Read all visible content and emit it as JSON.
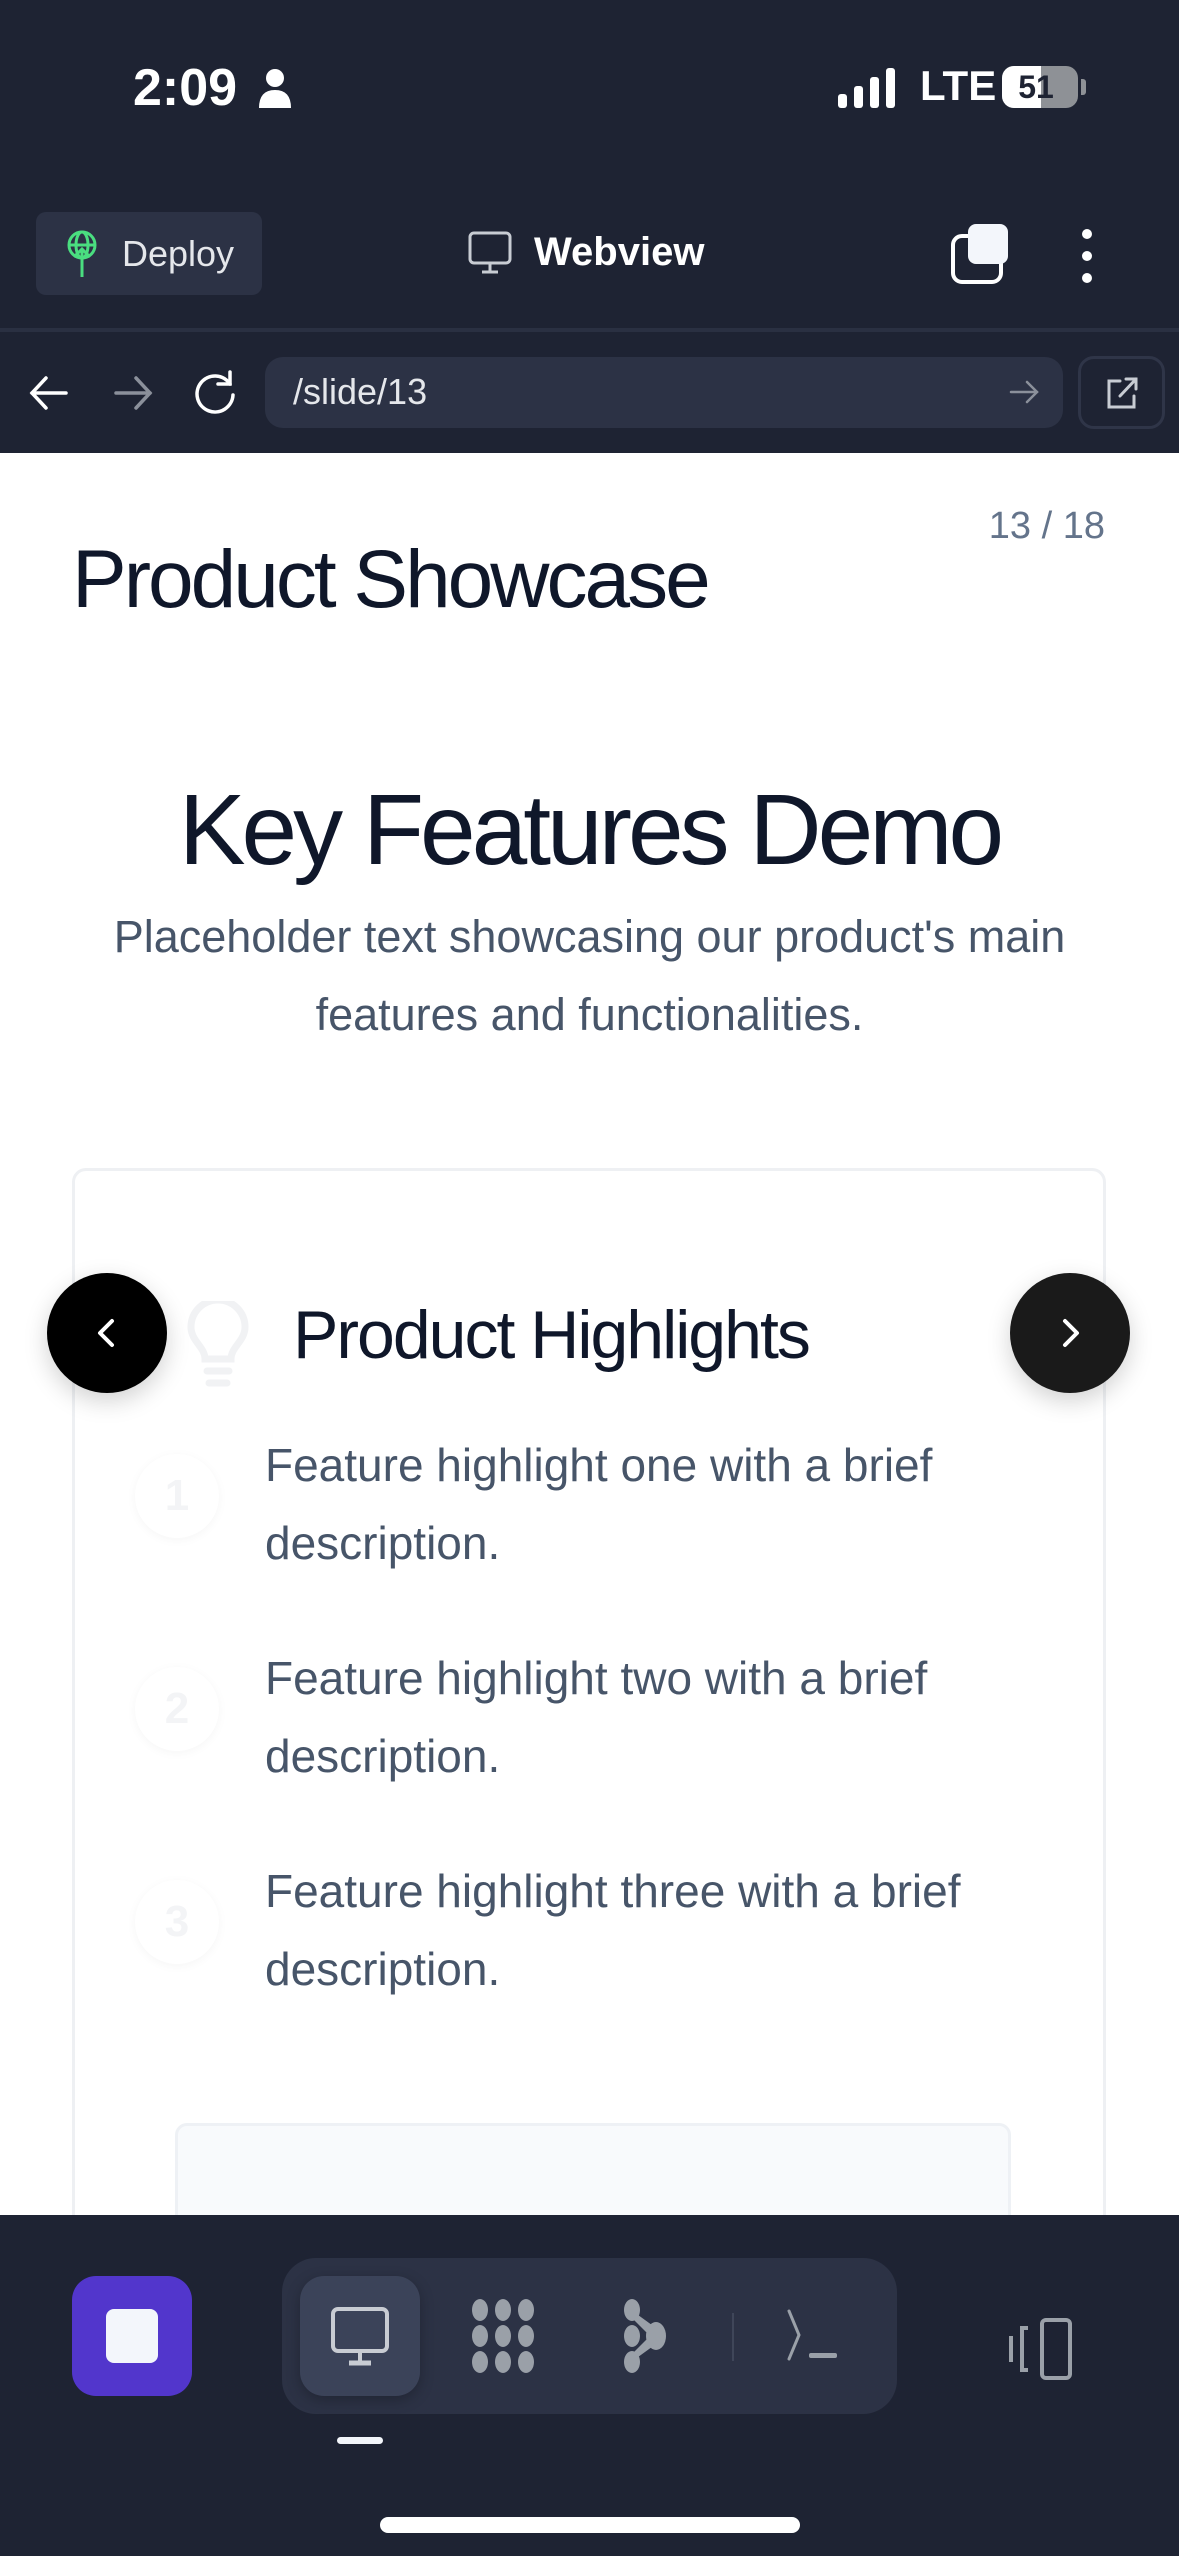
{
  "status_bar": {
    "time": "2:09",
    "network": "LTE",
    "battery": "51",
    "battery_level": 0.51,
    "icons": [
      "person-icon",
      "signal-icon",
      "battery-icon"
    ]
  },
  "header": {
    "deploy_label": "Deploy",
    "title": "Webview",
    "icons": [
      "deploy-globe-icon",
      "monitor-icon",
      "tabs-icon",
      "more-vertical-icon"
    ],
    "deploy_icon_color": "#4ade80"
  },
  "urlbar": {
    "url": "/slide/13",
    "icons": [
      "back-arrow-icon",
      "forward-arrow-icon",
      "reload-icon",
      "go-arrow-icon",
      "external-link-icon"
    ]
  },
  "slide": {
    "counter": "13 / 18",
    "deck_title": "Product Showcase",
    "heading": "Key Features Demo",
    "subtitle": "Placeholder text showcasing our product's main features and functionalities.",
    "card": {
      "title": "Product Highlights",
      "icon": "lightbulb-icon",
      "items": [
        {
          "number": "1",
          "text": "Feature highlight one with a brief description."
        },
        {
          "number": "2",
          "text": "Feature highlight two with a brief description."
        },
        {
          "number": "3",
          "text": "Feature highlight three with a brief description."
        }
      ]
    },
    "nav": {
      "prev_icon": "chevron-left-icon",
      "next_icon": "chevron-right-icon"
    }
  },
  "bottom_bar": {
    "accent": "#5236cc",
    "tabs": [
      "monitor-icon",
      "grid-dots-icon",
      "branch-icon",
      "terminal-icon"
    ],
    "active_tab": 0,
    "right_icon": "device-toggle-icon"
  }
}
